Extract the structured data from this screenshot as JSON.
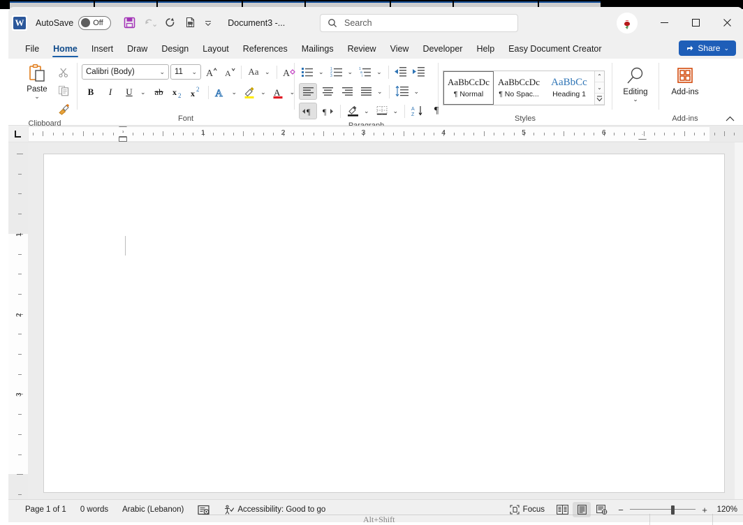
{
  "window": {
    "app_logo": "word-logo",
    "autosave_label": "AutoSave",
    "autosave_state": "Off",
    "document_title": "Document3  -...",
    "minimize": "─",
    "maximize": "□",
    "close": "✕",
    "avatar": "rose-avatar"
  },
  "quick_access": [
    {
      "name": "save-button",
      "icon": "save-icon",
      "enabled": true
    },
    {
      "name": "undo-button",
      "icon": "undo-icon",
      "enabled": false
    },
    {
      "name": "redo-button",
      "icon": "redo-icon",
      "enabled": true
    },
    {
      "name": "print-preview-button",
      "icon": "print-preview-icon",
      "enabled": true
    },
    {
      "name": "customize-qat-button",
      "icon": "chevron-down-icon",
      "enabled": true
    }
  ],
  "search": {
    "placeholder": "Search",
    "icon": "search-icon"
  },
  "tabs": [
    {
      "label": "File",
      "active": false
    },
    {
      "label": "Home",
      "active": true
    },
    {
      "label": "Insert",
      "active": false
    },
    {
      "label": "Draw",
      "active": false
    },
    {
      "label": "Design",
      "active": false
    },
    {
      "label": "Layout",
      "active": false
    },
    {
      "label": "References",
      "active": false
    },
    {
      "label": "Mailings",
      "active": false
    },
    {
      "label": "Review",
      "active": false
    },
    {
      "label": "View",
      "active": false
    },
    {
      "label": "Developer",
      "active": false
    },
    {
      "label": "Help",
      "active": false
    },
    {
      "label": "Easy Document Creator",
      "active": false
    }
  ],
  "share": {
    "label": "Share",
    "icon": "share-icon",
    "caret": "⌄",
    "color": "#1e5eb8"
  },
  "ribbon": {
    "clipboard": {
      "group_label": "Clipboard",
      "paste_label": "Paste",
      "paste_caret": "⌄",
      "cut_icon": "scissors-icon",
      "copy_icon": "copy-icon",
      "format_painter_icon": "format-painter-icon",
      "dialog_launcher": "dialog-launcher-icon"
    },
    "font": {
      "group_label": "Font",
      "font_name": "Calibri (Body)",
      "font_size": "11",
      "grow_font_icon": "grow-font-icon",
      "shrink_font_icon": "shrink-font-icon",
      "change_case_label": "Aa",
      "clear_formatting_icon": "clear-formatting-icon",
      "bold_label": "B",
      "italic_label": "I",
      "underline_label": "U",
      "strikethrough_label": "ab",
      "subscript_label": "x",
      "subscript_sub": "2",
      "superscript_label": "x",
      "superscript_sup": "2",
      "text_effects_label": "A",
      "highlight_label": "highlight-icon",
      "font_color_label": "A",
      "caret": "⌄",
      "dialog_launcher": "dialog-launcher-icon"
    },
    "paragraph": {
      "group_label": "Paragraph",
      "bullets_icon": "bullets-icon",
      "numbering_icon": "numbering-icon",
      "multilevel_icon": "multilevel-list-icon",
      "decrease_indent_icon": "decrease-indent-icon",
      "increase_indent_icon": "increase-indent-icon",
      "align_left_icon": "align-left-icon",
      "align_center_icon": "align-center-icon",
      "align_right_icon": "align-right-icon",
      "justify_icon": "justify-icon",
      "line_spacing_icon": "line-spacing-icon",
      "ltr_icon": "left-to-right-icon",
      "rtl_icon": "right-to-left-icon",
      "shading_icon": "shading-icon",
      "borders_icon": "borders-icon",
      "sort_icon": "sort-icon",
      "show_marks_icon": "show-formatting-marks-icon",
      "caret": "⌄",
      "dialog_launcher": "dialog-launcher-icon"
    },
    "styles": {
      "group_label": "Styles",
      "items": [
        {
          "preview": "AaBbCcDc",
          "name": "¶ Normal",
          "selected": true,
          "heading": false
        },
        {
          "preview": "AaBbCcDc",
          "name": "¶ No Spac...",
          "selected": false,
          "heading": false
        },
        {
          "preview": "AaBbCс",
          "name": "Heading 1",
          "selected": false,
          "heading": true
        }
      ],
      "scroll_up": "⌃",
      "scroll_down": "⌄",
      "scroll_more": "☰",
      "dialog_launcher": "dialog-launcher-icon"
    },
    "editing": {
      "label": "Editing",
      "icon": "magnifier-icon",
      "caret": "⌄"
    },
    "addins": {
      "group_label": "Add-ins",
      "label": "Add-ins",
      "icon": "addins-grid-icon"
    },
    "collapse_icon": "chevron-up-icon"
  },
  "ruler": {
    "corner_icon": "tab-stop-left-icon",
    "numbers": [
      "1",
      "2",
      "3",
      "4",
      "5",
      "6"
    ],
    "vertical_numbers": [
      "1",
      "2",
      "3"
    ],
    "first_line_indent": "first-line-indent-marker",
    "hanging_indent": "hanging-indent-marker",
    "left_indent": "left-indent-marker",
    "right_indent": "right-indent-marker"
  },
  "document": {
    "caret": "text-cursor",
    "content": ""
  },
  "status": {
    "page": "Page 1 of 1",
    "words": "0 words",
    "language": "Arabic (Lebanon)",
    "proofing_icon": "proofing-errors-icon",
    "accessibility_icon": "accessibility-icon",
    "accessibility": "Accessibility: Good to go",
    "focus_icon": "focus-icon",
    "focus": "Focus",
    "view_read_icon": "read-mode-icon",
    "view_print_icon": "print-layout-icon",
    "view_web_icon": "web-layout-icon",
    "zoom_out": "−",
    "zoom_in": "+",
    "zoom_value": "120%"
  },
  "background_window": {
    "ghost_text": "Alt+Shift"
  }
}
